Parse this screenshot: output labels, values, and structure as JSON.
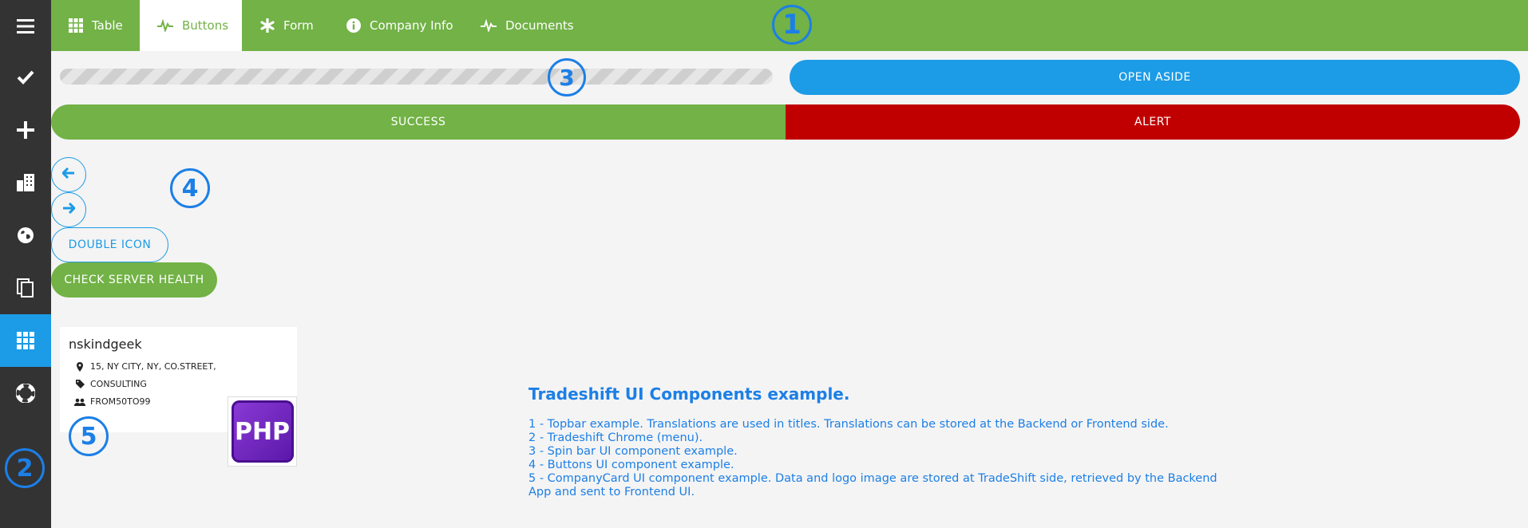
{
  "topbar": {
    "tabs": [
      {
        "label": "Table",
        "icon": "grid-icon",
        "active": false
      },
      {
        "label": "Buttons",
        "icon": "pulse-icon",
        "active": true
      },
      {
        "label": "Form",
        "icon": "asterisk-icon",
        "active": false
      },
      {
        "label": "Company Info",
        "icon": "info-icon",
        "active": false
      },
      {
        "label": "Documents",
        "icon": "pulse-icon",
        "active": false
      }
    ]
  },
  "sidebar": {
    "items": [
      {
        "icon": "menu-icon",
        "active": false
      },
      {
        "icon": "checkmark-icon",
        "active": false
      },
      {
        "icon": "plus-icon",
        "active": false
      },
      {
        "icon": "buildings-icon",
        "active": false
      },
      {
        "icon": "globe-icon",
        "active": false
      },
      {
        "icon": "documents-icon",
        "active": false
      },
      {
        "icon": "apps-grid-icon",
        "active": true
      },
      {
        "icon": "lifebuoy-icon",
        "active": false
      }
    ]
  },
  "annotations": {
    "n1": "1",
    "n2": "2",
    "n3": "3",
    "n4": "4",
    "n5": "5"
  },
  "buttons": {
    "open_aside": "OPEN ASIDE",
    "success": "SUCCESS",
    "alert": "ALERT",
    "double_icon": "DOUBLE ICON",
    "check_server_health": "CHECK SERVER HEALTH"
  },
  "company_card": {
    "name": "nskindgeek",
    "address": "15, NY CITY, NY, CO.STREET,",
    "industry": "CONSULTING",
    "size": "FROM50TO99",
    "logo_text": "PHP"
  },
  "description": {
    "title": "Tradeshift UI Components example.",
    "lines": [
      "1 - Topbar example. Translations are used in titles. Translations can be stored at the Backend or Frontend side.",
      "2 - Tradeshift Chrome (menu).",
      "3 - Spin bar UI component example.",
      "4 - Buttons UI component example.",
      "5 - CompanyCard UI component example. Data and logo image are stored at TradeShift side, retrieved by the Backend App and sent to Frontend UI."
    ]
  },
  "colors": {
    "topbar_green": "#72b246",
    "sidebar_dark": "#333333",
    "accent_blue": "#1c9be6",
    "alert_red": "#c00000",
    "annotation_blue": "#1c7fe6"
  }
}
